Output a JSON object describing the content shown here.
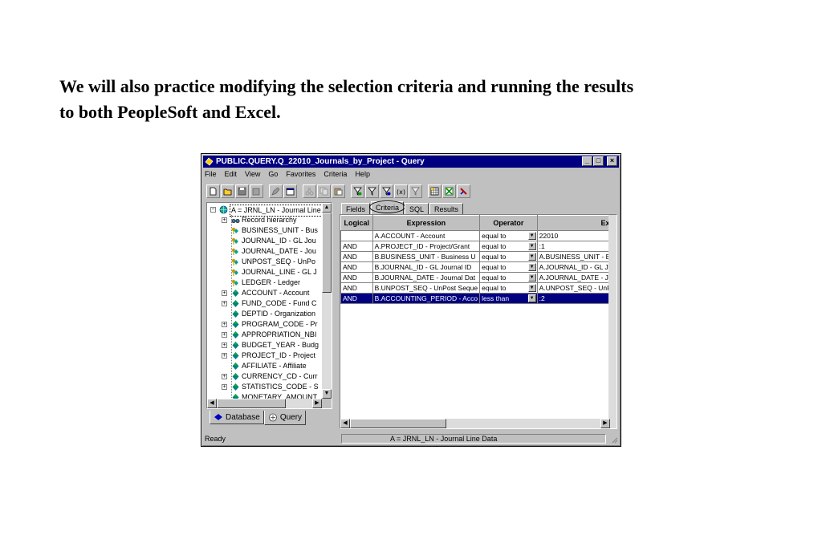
{
  "slide": {
    "line1": "We will also practice modifying the selection criteria and running the results",
    "line2": "to both PeopleSoft and Excel."
  },
  "window": {
    "title": "PUBLIC.QUERY.Q_22010_Journals_by_Project - Query",
    "controls": {
      "minimize": "_",
      "maximize": "□",
      "close": "×"
    }
  },
  "menu": [
    {
      "label": "File"
    },
    {
      "label": "Edit"
    },
    {
      "label": "View"
    },
    {
      "label": "Go"
    },
    {
      "label": "Favorites"
    },
    {
      "label": "Criteria"
    },
    {
      "label": "Help"
    }
  ],
  "tree": {
    "root": "A = JRNL_LN - Journal Line",
    "items": [
      {
        "label": "Record hierarchy",
        "icon": "binoculars-icon",
        "expander": "+"
      },
      {
        "label": "BUSINESS_UNIT - Bus",
        "icon": "key-field-icon",
        "expander": ""
      },
      {
        "label": "JOURNAL_ID - GL Jou",
        "icon": "key-field-icon",
        "expander": ""
      },
      {
        "label": "JOURNAL_DATE - Jou",
        "icon": "key-field-icon",
        "expander": ""
      },
      {
        "label": "UNPOST_SEQ - UnPo",
        "icon": "key-field-icon",
        "expander": ""
      },
      {
        "label": "JOURNAL_LINE - GL J",
        "icon": "key-field-icon",
        "expander": ""
      },
      {
        "label": "LEDGER - Ledger",
        "icon": "key-field-icon",
        "expander": ""
      },
      {
        "label": "ACCOUNT - Account",
        "icon": "field-icon",
        "expander": "+"
      },
      {
        "label": "FUND_CODE - Fund C",
        "icon": "field-icon",
        "expander": "+"
      },
      {
        "label": "DEPTID - Organization",
        "icon": "field-icon",
        "expander": ""
      },
      {
        "label": "PROGRAM_CODE - Pr",
        "icon": "field-icon",
        "expander": "+"
      },
      {
        "label": "APPROPRIATION_NBI",
        "icon": "field-icon",
        "expander": "+"
      },
      {
        "label": "BUDGET_YEAR - Budg",
        "icon": "field-icon",
        "expander": "+"
      },
      {
        "label": "PROJECT_ID - Project",
        "icon": "field-icon",
        "expander": "+"
      },
      {
        "label": "AFFILIATE - Affiliate",
        "icon": "field-icon",
        "expander": ""
      },
      {
        "label": "CURRENCY_CD - Curr",
        "icon": "field-icon",
        "expander": "+"
      },
      {
        "label": "STATISTICS_CODE - S",
        "icon": "field-icon",
        "expander": "+"
      },
      {
        "label": "MONETARY_AMOUNT",
        "icon": "field-icon",
        "expander": ""
      }
    ]
  },
  "left_tabs": [
    {
      "label": "Database",
      "icon": "database-icon"
    },
    {
      "label": "Query",
      "icon": "query-icon"
    }
  ],
  "right_tabs": [
    {
      "label": "Fields"
    },
    {
      "label": "Criteria"
    },
    {
      "label": "SQL"
    },
    {
      "label": "Results"
    }
  ],
  "grid": {
    "headers": {
      "logical": "Logical",
      "expression": "Expression",
      "operator": "Operator",
      "expr2": "Exp"
    },
    "rows": [
      {
        "logical": "",
        "expression": "A.ACCOUNT - Account",
        "operator": "equal to",
        "expr2": "22010"
      },
      {
        "logical": "AND",
        "expression": "A.PROJECT_ID - Project/Grant",
        "operator": "equal to",
        "expr2": ":1"
      },
      {
        "logical": "AND",
        "expression": "B.BUSINESS_UNIT - Business U",
        "operator": "equal to",
        "expr2": "A.BUSINESS_UNIT - Bu"
      },
      {
        "logical": "AND",
        "expression": "B.JOURNAL_ID - GL Journal ID",
        "operator": "equal to",
        "expr2": "A.JOURNAL_ID - GL Jo"
      },
      {
        "logical": "AND",
        "expression": "B.JOURNAL_DATE - Journal Dat",
        "operator": "equal to",
        "expr2": "A.JOURNAL_DATE - Jo"
      },
      {
        "logical": "AND",
        "expression": "B.UNPOST_SEQ - UnPost Seque",
        "operator": "equal to",
        "expr2": "A.UNPOST_SEQ - UnP"
      },
      {
        "logical": "AND",
        "expression": "B.ACCOUNTING_PERIOD - Acco",
        "operator": "less than",
        "expr2": ":2",
        "selected": true
      }
    ]
  },
  "status": {
    "left": "Ready",
    "right": "A = JRNL_LN - Journal Line Data"
  },
  "colors": {
    "titlebar": "#000080",
    "face": "#c0c0c0",
    "selection": "#000080"
  }
}
